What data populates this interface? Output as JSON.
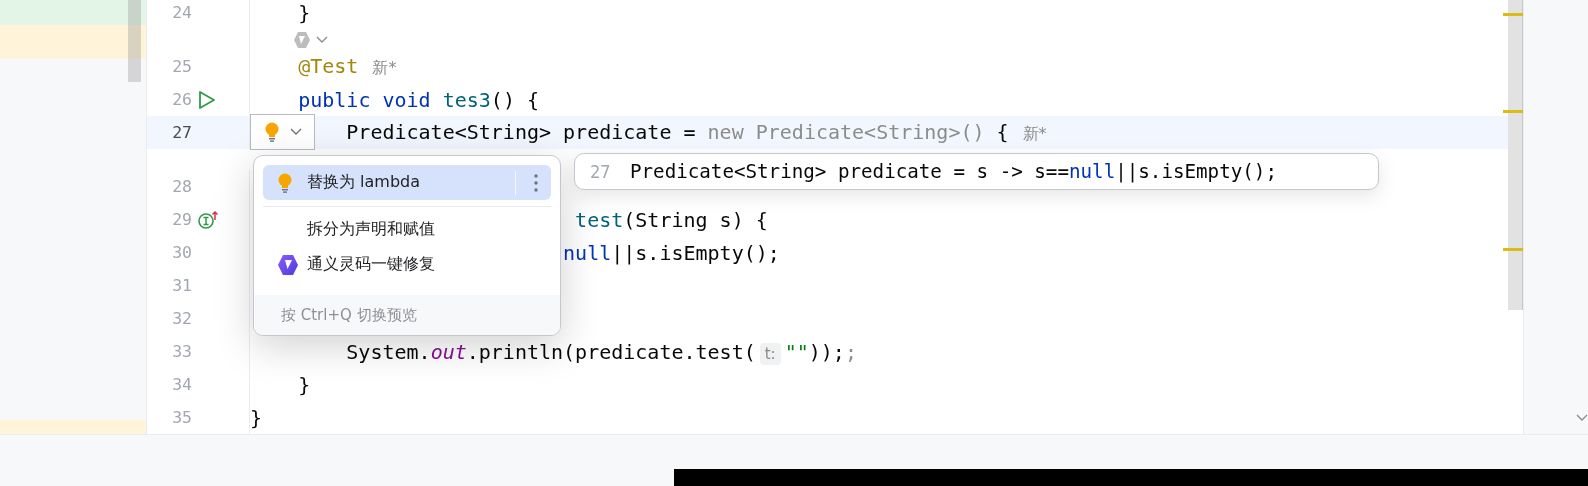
{
  "editor": {
    "lines": [
      {
        "kind": "code",
        "number": "24",
        "current": false,
        "segments": [
          {
            "kind": "plain",
            "text": "    }"
          }
        ]
      },
      {
        "kind": "inlay"
      },
      {
        "kind": "code",
        "number": "25",
        "current": false,
        "segments": [
          {
            "kind": "annotation",
            "text": "    @Test"
          },
          {
            "kind": "hint",
            "text": "新*"
          }
        ]
      },
      {
        "kind": "test-method",
        "number": "26",
        "current": false,
        "segments": [
          {
            "kind": "keyword",
            "text": "    public void "
          },
          {
            "kind": "method",
            "text": "tes3"
          },
          {
            "kind": "plain",
            "text": "() {"
          }
        ]
      },
      {
        "kind": "code",
        "number": "27",
        "current": true,
        "segments": [
          {
            "kind": "plain",
            "text": "        Predicate<String> predicate = "
          },
          {
            "kind": "dim",
            "text": "new Predicate<String>()"
          },
          {
            "kind": "plain",
            "text": " {"
          },
          {
            "kind": "hint",
            "text": "新*"
          }
        ]
      },
      {
        "kind": "code",
        "number": "28",
        "current": false,
        "gap_above": true
      },
      {
        "kind": "override",
        "number": "29",
        "current": false,
        "segments": [
          {
            "kind": "method",
            "text": "                           test"
          },
          {
            "kind": "plain",
            "text": "(String s) {"
          }
        ]
      },
      {
        "kind": "code",
        "number": "30",
        "current": false,
        "segments": [
          {
            "kind": "keyword",
            "text": "                          null"
          },
          {
            "kind": "plain",
            "text": "||s.isEmpty();"
          }
        ]
      },
      {
        "kind": "code",
        "number": "31",
        "current": false
      },
      {
        "kind": "code",
        "number": "32",
        "current": false
      },
      {
        "kind": "code",
        "number": "33",
        "current": false,
        "segments": [
          {
            "kind": "plain",
            "text": "        System."
          },
          {
            "kind": "static",
            "text": "out"
          },
          {
            "kind": "plain",
            "text": ".println(predicate.test("
          },
          {
            "kind": "param",
            "text": "t:"
          },
          {
            "kind": "string",
            "text": "\"\""
          },
          {
            "kind": "plain",
            "text": "));"
          },
          {
            "kind": "dim",
            "text": ";"
          }
        ]
      },
      {
        "kind": "code",
        "number": "34",
        "current": false,
        "segments": [
          {
            "kind": "plain",
            "text": "    }"
          }
        ]
      },
      {
        "kind": "code",
        "number": "35",
        "current": false,
        "segments": [
          {
            "kind": "plain",
            "text": "}"
          }
        ]
      }
    ]
  },
  "intention_popup": {
    "items": [
      {
        "kind": "quick-fix",
        "label": "替换为 lambda",
        "selected": true,
        "has_menu": true
      },
      {
        "kind": "plain",
        "label": "拆分为声明和赋值",
        "selected": false,
        "has_menu": false
      },
      {
        "kind": "assistant",
        "label": "通义灵码一键修复",
        "selected": false,
        "has_menu": false
      }
    ],
    "footer": "按 Ctrl+Q 切换预览"
  },
  "preview": {
    "line_number": "27",
    "segments": [
      {
        "kind": "plain",
        "text": "Predicate<String> predicate = s -> s=="
      },
      {
        "kind": "keyword",
        "text": "null"
      },
      {
        "kind": "plain",
        "text": "||s.isEmpty();"
      }
    ]
  }
}
